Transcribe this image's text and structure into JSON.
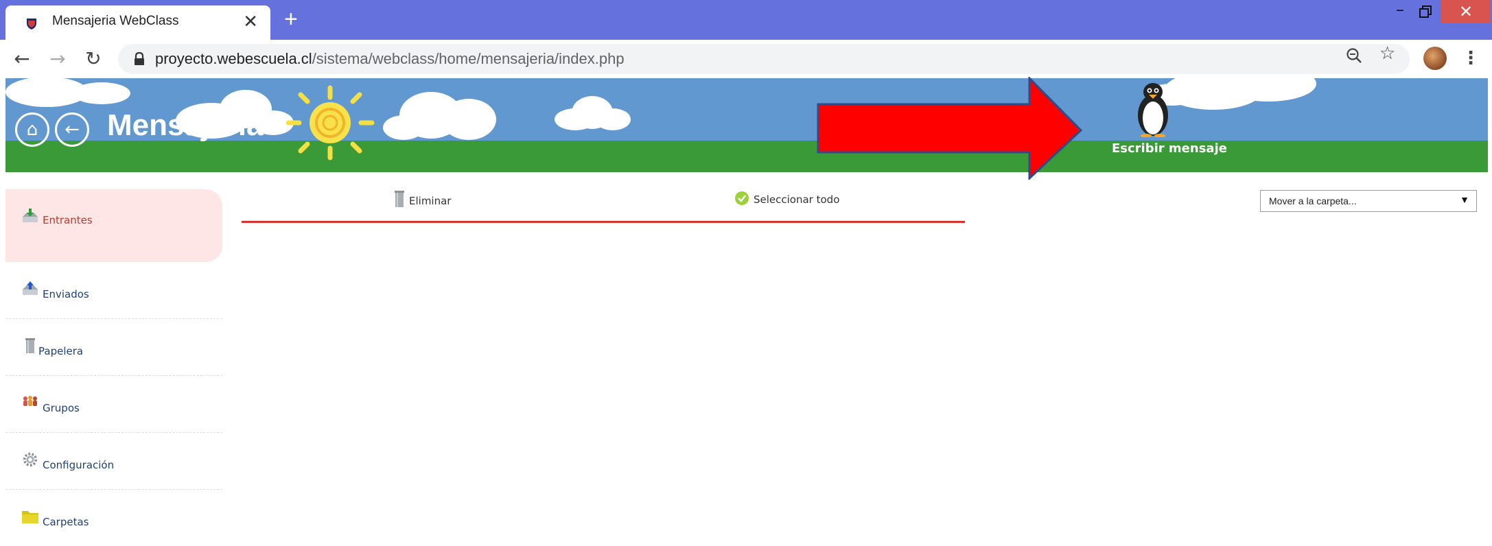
{
  "browser": {
    "tab_title": "Mensajeria WebClass",
    "tab_close": "✕",
    "new_tab": "+",
    "url_domain": "proyecto.webescuela.cl",
    "url_path": "/sistema/webclass/home/mensajeria/index.php",
    "window_min": "–",
    "window_close": "✕"
  },
  "banner": {
    "title": "Mensajería",
    "write_message": "Escribir mensaje"
  },
  "sidebar": {
    "items": [
      {
        "label": "Entrantes",
        "icon": "inbox-download-icon"
      },
      {
        "label": "Enviados",
        "icon": "outbox-upload-icon"
      },
      {
        "label": "Papelera",
        "icon": "trash-icon"
      },
      {
        "label": "Grupos",
        "icon": "group-icon"
      },
      {
        "label": "Configuración",
        "icon": "gear-icon"
      },
      {
        "label": "Carpetas",
        "icon": "folder-icon"
      }
    ]
  },
  "toolbar": {
    "delete_label": "Eliminar",
    "select_all_label": "Seleccionar todo"
  },
  "folder_select": {
    "selected": "Mover a la carpeta..."
  },
  "colors": {
    "tab_bar": "#6571dc",
    "banner_sky": "#6098cf",
    "grass": "#3a9a38",
    "accent_red": "#d9332f",
    "arrow_red": "#ff0000"
  }
}
